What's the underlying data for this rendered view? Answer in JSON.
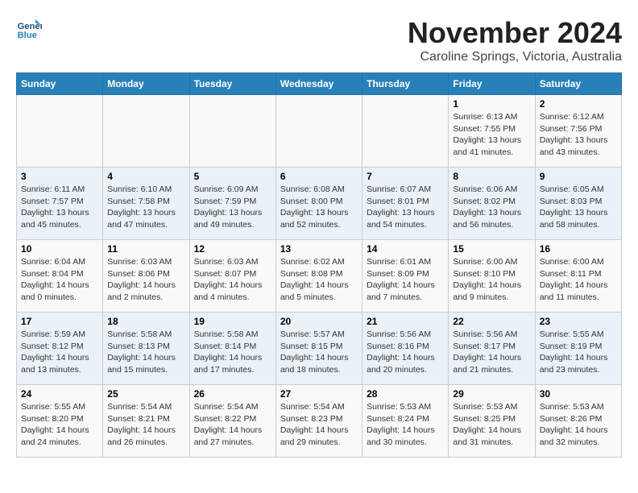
{
  "header": {
    "logo_line1": "General",
    "logo_line2": "Blue",
    "title": "November 2024",
    "subtitle": "Caroline Springs, Victoria, Australia"
  },
  "weekdays": [
    "Sunday",
    "Monday",
    "Tuesday",
    "Wednesday",
    "Thursday",
    "Friday",
    "Saturday"
  ],
  "weeks": [
    [
      {
        "day": "",
        "info": ""
      },
      {
        "day": "",
        "info": ""
      },
      {
        "day": "",
        "info": ""
      },
      {
        "day": "",
        "info": ""
      },
      {
        "day": "",
        "info": ""
      },
      {
        "day": "1",
        "info": "Sunrise: 6:13 AM\nSunset: 7:55 PM\nDaylight: 13 hours\nand 41 minutes."
      },
      {
        "day": "2",
        "info": "Sunrise: 6:12 AM\nSunset: 7:56 PM\nDaylight: 13 hours\nand 43 minutes."
      }
    ],
    [
      {
        "day": "3",
        "info": "Sunrise: 6:11 AM\nSunset: 7:57 PM\nDaylight: 13 hours\nand 45 minutes."
      },
      {
        "day": "4",
        "info": "Sunrise: 6:10 AM\nSunset: 7:58 PM\nDaylight: 13 hours\nand 47 minutes."
      },
      {
        "day": "5",
        "info": "Sunrise: 6:09 AM\nSunset: 7:59 PM\nDaylight: 13 hours\nand 49 minutes."
      },
      {
        "day": "6",
        "info": "Sunrise: 6:08 AM\nSunset: 8:00 PM\nDaylight: 13 hours\nand 52 minutes."
      },
      {
        "day": "7",
        "info": "Sunrise: 6:07 AM\nSunset: 8:01 PM\nDaylight: 13 hours\nand 54 minutes."
      },
      {
        "day": "8",
        "info": "Sunrise: 6:06 AM\nSunset: 8:02 PM\nDaylight: 13 hours\nand 56 minutes."
      },
      {
        "day": "9",
        "info": "Sunrise: 6:05 AM\nSunset: 8:03 PM\nDaylight: 13 hours\nand 58 minutes."
      }
    ],
    [
      {
        "day": "10",
        "info": "Sunrise: 6:04 AM\nSunset: 8:04 PM\nDaylight: 14 hours\nand 0 minutes."
      },
      {
        "day": "11",
        "info": "Sunrise: 6:03 AM\nSunset: 8:06 PM\nDaylight: 14 hours\nand 2 minutes."
      },
      {
        "day": "12",
        "info": "Sunrise: 6:03 AM\nSunset: 8:07 PM\nDaylight: 14 hours\nand 4 minutes."
      },
      {
        "day": "13",
        "info": "Sunrise: 6:02 AM\nSunset: 8:08 PM\nDaylight: 14 hours\nand 5 minutes."
      },
      {
        "day": "14",
        "info": "Sunrise: 6:01 AM\nSunset: 8:09 PM\nDaylight: 14 hours\nand 7 minutes."
      },
      {
        "day": "15",
        "info": "Sunrise: 6:00 AM\nSunset: 8:10 PM\nDaylight: 14 hours\nand 9 minutes."
      },
      {
        "day": "16",
        "info": "Sunrise: 6:00 AM\nSunset: 8:11 PM\nDaylight: 14 hours\nand 11 minutes."
      }
    ],
    [
      {
        "day": "17",
        "info": "Sunrise: 5:59 AM\nSunset: 8:12 PM\nDaylight: 14 hours\nand 13 minutes."
      },
      {
        "day": "18",
        "info": "Sunrise: 5:58 AM\nSunset: 8:13 PM\nDaylight: 14 hours\nand 15 minutes."
      },
      {
        "day": "19",
        "info": "Sunrise: 5:58 AM\nSunset: 8:14 PM\nDaylight: 14 hours\nand 17 minutes."
      },
      {
        "day": "20",
        "info": "Sunrise: 5:57 AM\nSunset: 8:15 PM\nDaylight: 14 hours\nand 18 minutes."
      },
      {
        "day": "21",
        "info": "Sunrise: 5:56 AM\nSunset: 8:16 PM\nDaylight: 14 hours\nand 20 minutes."
      },
      {
        "day": "22",
        "info": "Sunrise: 5:56 AM\nSunset: 8:17 PM\nDaylight: 14 hours\nand 21 minutes."
      },
      {
        "day": "23",
        "info": "Sunrise: 5:55 AM\nSunset: 8:19 PM\nDaylight: 14 hours\nand 23 minutes."
      }
    ],
    [
      {
        "day": "24",
        "info": "Sunrise: 5:55 AM\nSunset: 8:20 PM\nDaylight: 14 hours\nand 24 minutes."
      },
      {
        "day": "25",
        "info": "Sunrise: 5:54 AM\nSunset: 8:21 PM\nDaylight: 14 hours\nand 26 minutes."
      },
      {
        "day": "26",
        "info": "Sunrise: 5:54 AM\nSunset: 8:22 PM\nDaylight: 14 hours\nand 27 minutes."
      },
      {
        "day": "27",
        "info": "Sunrise: 5:54 AM\nSunset: 8:23 PM\nDaylight: 14 hours\nand 29 minutes."
      },
      {
        "day": "28",
        "info": "Sunrise: 5:53 AM\nSunset: 8:24 PM\nDaylight: 14 hours\nand 30 minutes."
      },
      {
        "day": "29",
        "info": "Sunrise: 5:53 AM\nSunset: 8:25 PM\nDaylight: 14 hours\nand 31 minutes."
      },
      {
        "day": "30",
        "info": "Sunrise: 5:53 AM\nSunset: 8:26 PM\nDaylight: 14 hours\nand 32 minutes."
      }
    ]
  ]
}
